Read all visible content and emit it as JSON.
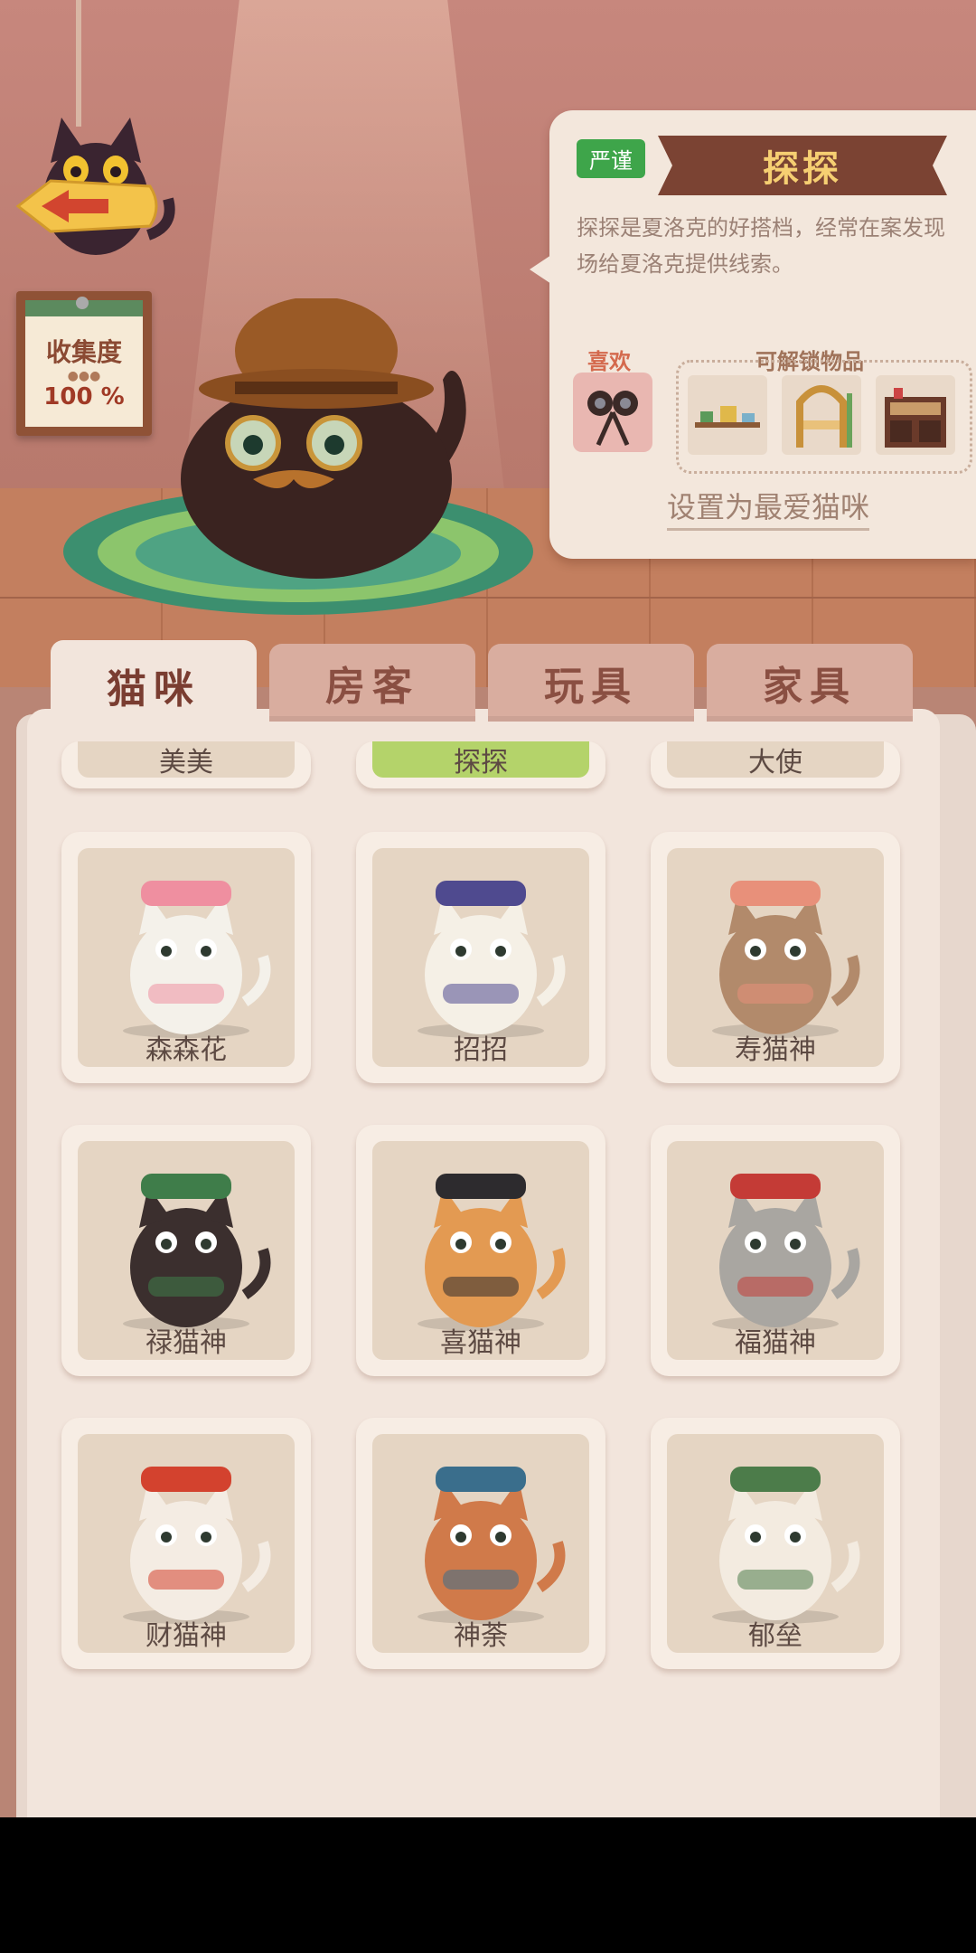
{
  "collection": {
    "title": "收集度",
    "value": "100",
    "unit": "%"
  },
  "cat_info": {
    "tag": "严谨",
    "name": "探探",
    "description": "探探是夏洛克的好搭档，经常在案发现场给夏洛克提供线索。",
    "like_label": "喜欢",
    "like_item_icon": "binoculars-icon",
    "unlock_label": "可解锁物品",
    "unlock_items": [
      "plant-shelf-icon",
      "wicker-chair-icon",
      "bookcase-icon"
    ],
    "set_favorite": "设置为最爱猫咪"
  },
  "tabs": [
    "猫咪",
    "房客",
    "玩具",
    "家具"
  ],
  "active_tab": 0,
  "partial_row": [
    "美美",
    "探探",
    "大使"
  ],
  "cats": [
    {
      "name": "森森花",
      "body": "#f4f1ea",
      "accent": "#ef8fa0"
    },
    {
      "name": "招招",
      "body": "#f5f0e6",
      "accent": "#4f4a8f"
    },
    {
      "name": "寿猫神",
      "body": "#b28a6b",
      "accent": "#e8907a"
    },
    {
      "name": "禄猫神",
      "body": "#3b2f2e",
      "accent": "#3f7d4a"
    },
    {
      "name": "喜猫神",
      "body": "#e39a52",
      "accent": "#2d2b2e"
    },
    {
      "name": "福猫神",
      "body": "#a9a6a1",
      "accent": "#c43b36"
    },
    {
      "name": "财猫神",
      "body": "#f4ece3",
      "accent": "#d3422e"
    },
    {
      "name": "神荼",
      "body": "#d07a4a",
      "accent": "#3a6e8c"
    },
    {
      "name": "郁垒",
      "body": "#f3ebe0",
      "accent": "#4c7c4a"
    }
  ],
  "colors": {
    "accent_green": "#3ea54a",
    "banner_brown": "#7b4333",
    "banner_text": "#f6cf72"
  }
}
